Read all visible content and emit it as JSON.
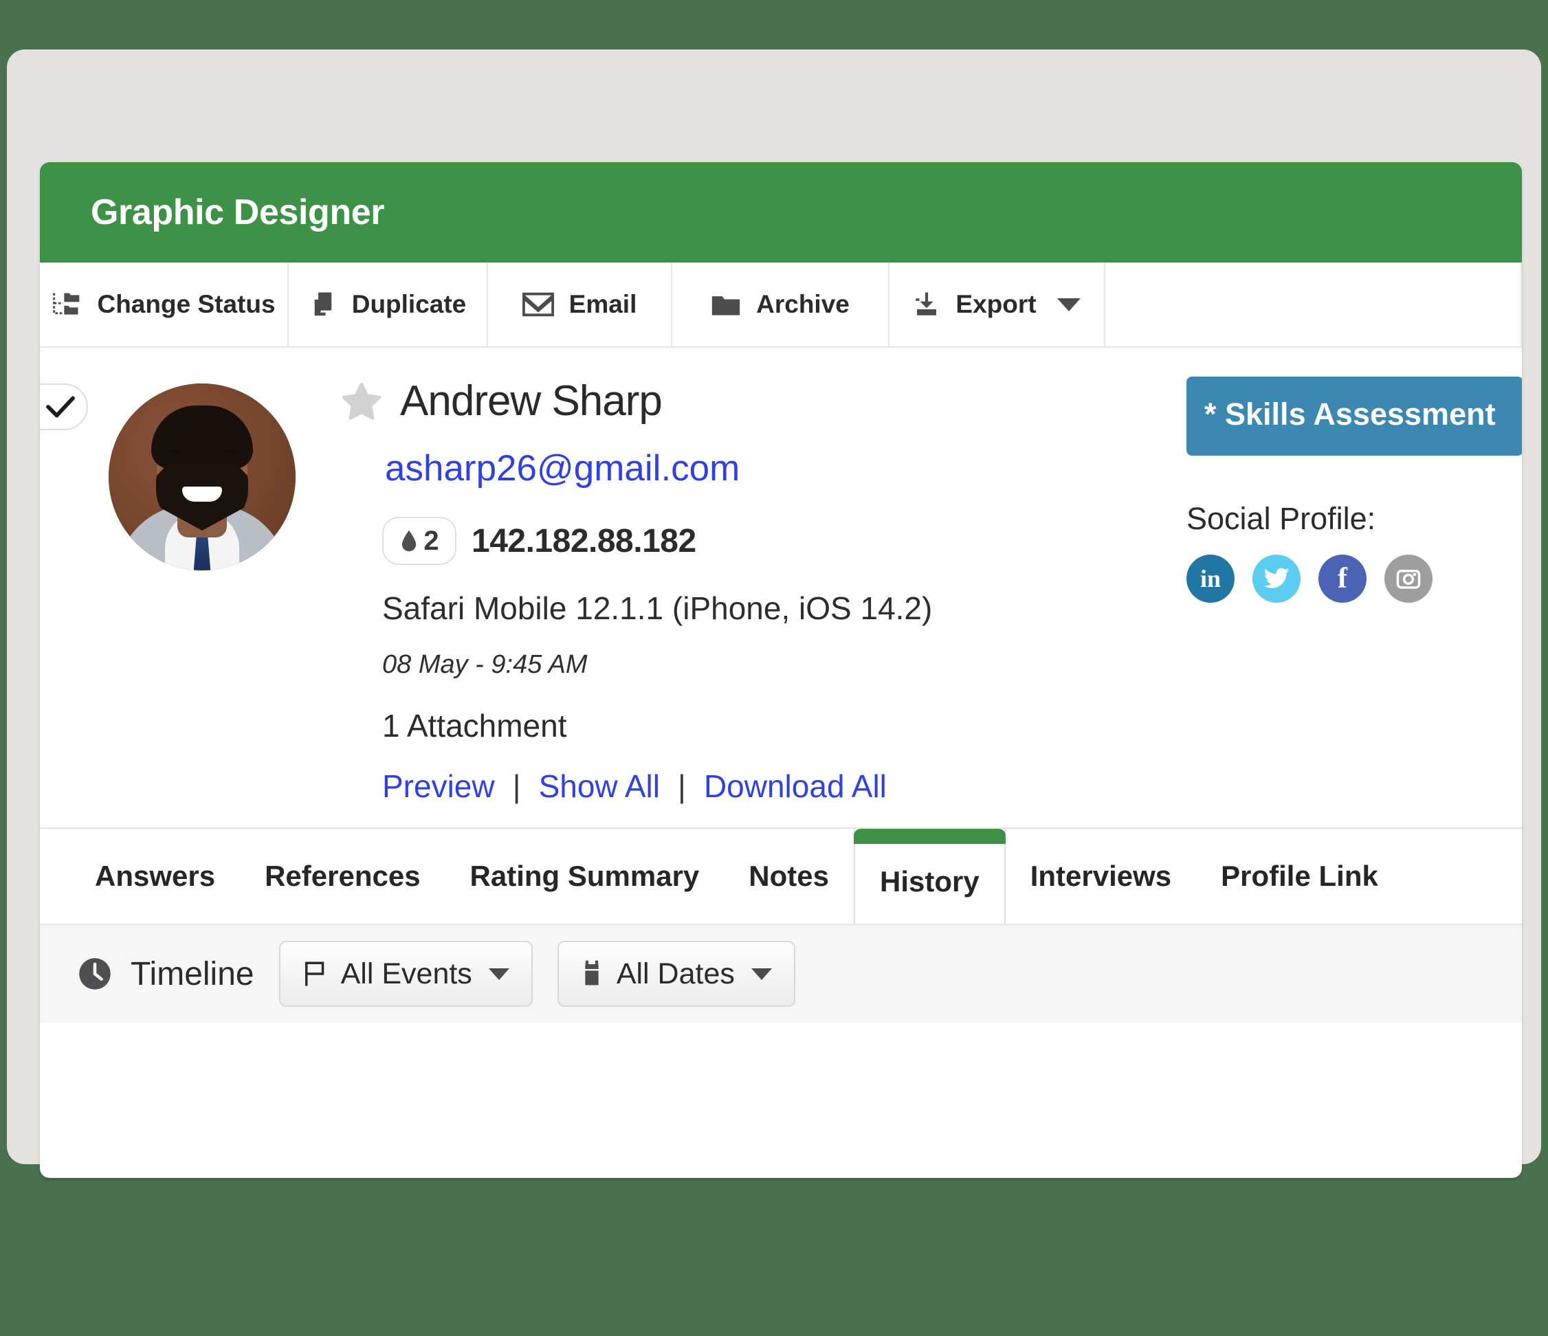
{
  "header": {
    "title": "Graphic Designer",
    "bg_color": "#3d9247"
  },
  "toolbar": {
    "items": [
      {
        "label": "Change Status",
        "icon": "sitemap-icon"
      },
      {
        "label": "Duplicate",
        "icon": "duplicate-icon"
      },
      {
        "label": "Email",
        "icon": "envelope-icon"
      },
      {
        "label": "Archive",
        "icon": "folder-icon"
      },
      {
        "label": "Export",
        "icon": "download-icon",
        "has_caret": true
      }
    ]
  },
  "candidate": {
    "select_icon": "check-icon",
    "favorite_icon": "star-icon",
    "name": "Andrew Sharp",
    "email": "asharp26@gmail.com",
    "rating_count": "2",
    "rating_icon": "droplet-icon",
    "ip_address": "142.182.88.182",
    "browser": "Safari Mobile 12.1.1 (iPhone, iOS 14.2)",
    "timestamp": "08 May - 9:45 AM",
    "attachment_count": "1 Attachment",
    "attachment_actions": {
      "preview": "Preview",
      "show_all": "Show All",
      "download_all": "Download All",
      "separator": "|"
    }
  },
  "sidebar": {
    "skills_button": "* Skills Assessment",
    "skills_button_color": "#3b89b0",
    "social_label": "Social Profile:",
    "social_links": [
      {
        "name": "linkedin-icon",
        "glyph": "in",
        "color": "#2176a3"
      },
      {
        "name": "twitter-icon",
        "glyph": "",
        "color": "#5ccdf2"
      },
      {
        "name": "facebook-icon",
        "glyph": "f",
        "color": "#4a63b5"
      },
      {
        "name": "instagram-icon",
        "glyph": "",
        "color": "#9e9e9e"
      }
    ]
  },
  "tabs": {
    "items": [
      {
        "label": "Answers",
        "active": false
      },
      {
        "label": "References",
        "active": false
      },
      {
        "label": "Rating Summary",
        "active": false
      },
      {
        "label": "Notes",
        "active": false
      },
      {
        "label": "History",
        "active": true
      },
      {
        "label": "Interviews",
        "active": false
      },
      {
        "label": "Profile Link",
        "active": false
      }
    ],
    "active_indicator_color": "#3d9247"
  },
  "timeline": {
    "label": "Timeline",
    "label_icon": "clock-icon",
    "filters": [
      {
        "label": "All Events",
        "icon": "flag-icon"
      },
      {
        "label": "All Dates",
        "icon": "calendar-icon"
      }
    ]
  }
}
